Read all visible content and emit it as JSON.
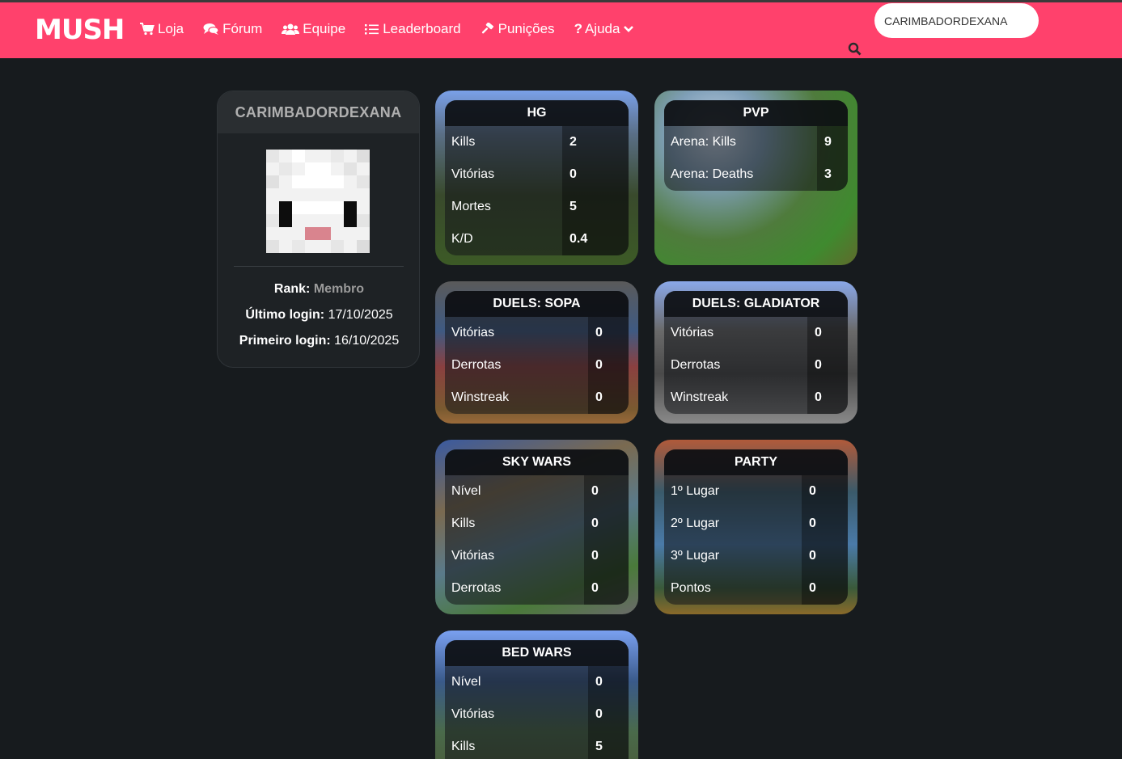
{
  "brand": {
    "logo_text": "MUSH"
  },
  "nav": {
    "items": [
      {
        "label": "Loja",
        "icon": "cart-icon"
      },
      {
        "label": "Fórum",
        "icon": "comments-icon"
      },
      {
        "label": "Equipe",
        "icon": "users-icon"
      },
      {
        "label": "Leaderboard",
        "icon": "list-icon"
      },
      {
        "label": "Punições",
        "icon": "gavel-icon"
      },
      {
        "label": "Ajuda",
        "icon": "question-icon"
      }
    ],
    "search_value": "CARIMBADORDEXANA"
  },
  "colors": {
    "navbar": "#ff416c",
    "background": "#171b1e"
  },
  "profile": {
    "username": "CARIMBADORDEXANA",
    "rank_label": "Rank:",
    "rank_value": "Membro",
    "last_login_label": "Último login:",
    "last_login_value": "17/10/2025",
    "first_login_label": "Primeiro login:",
    "first_login_value": "16/10/2025"
  },
  "cards": {
    "hg": {
      "title": "HG",
      "rows": [
        {
          "label": "Kills",
          "value": "2"
        },
        {
          "label": "Vitórias",
          "value": "0"
        },
        {
          "label": "Mortes",
          "value": "5"
        },
        {
          "label": "K/D",
          "value": "0.4"
        }
      ]
    },
    "pvp": {
      "title": "PVP",
      "rows": [
        {
          "label": "Arena: Kills",
          "value": "9"
        },
        {
          "label": "Arena: Deaths",
          "value": "3"
        }
      ]
    },
    "duels_sopa": {
      "title": "DUELS: SOPA",
      "rows": [
        {
          "label": "Vitórias",
          "value": "0"
        },
        {
          "label": "Derrotas",
          "value": "0"
        },
        {
          "label": "Winstreak",
          "value": "0"
        }
      ]
    },
    "duels_gladiator": {
      "title": "DUELS: GLADIATOR",
      "rows": [
        {
          "label": "Vitórias",
          "value": "0"
        },
        {
          "label": "Derrotas",
          "value": "0"
        },
        {
          "label": "Winstreak",
          "value": "0"
        }
      ]
    },
    "sky_wars": {
      "title": "SKY WARS",
      "rows": [
        {
          "label": "Nível",
          "value": "0"
        },
        {
          "label": "Kills",
          "value": "0"
        },
        {
          "label": "Vitórias",
          "value": "0"
        },
        {
          "label": "Derrotas",
          "value": "0"
        }
      ]
    },
    "party": {
      "title": "PARTY",
      "rows": [
        {
          "label": "1º Lugar",
          "value": "0"
        },
        {
          "label": "2º Lugar",
          "value": "0"
        },
        {
          "label": "3º Lugar",
          "value": "0"
        },
        {
          "label": "Pontos",
          "value": "0"
        }
      ]
    },
    "bed_wars": {
      "title": "BED WARS",
      "rows": [
        {
          "label": "Nível",
          "value": "0"
        },
        {
          "label": "Vitórias",
          "value": "0"
        },
        {
          "label": "Kills",
          "value": "5"
        }
      ]
    }
  }
}
